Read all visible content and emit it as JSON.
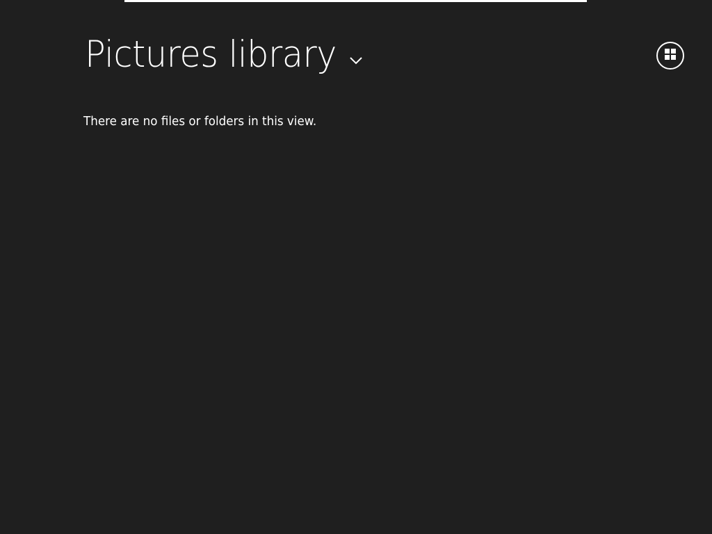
{
  "header": {
    "title": "Pictures library"
  },
  "content": {
    "empty_message": "There are no files or folders in this view."
  },
  "icons": {
    "title_dropdown": "chevron-down-icon",
    "view_toggle": "grid-view-icon"
  },
  "colors": {
    "background": "#1f1f1f",
    "foreground": "#ffffff"
  }
}
